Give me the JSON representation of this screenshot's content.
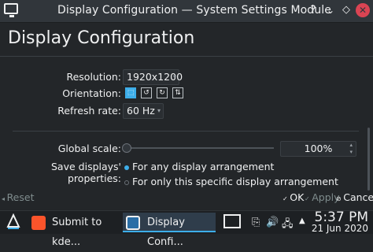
{
  "window": {
    "title": "Display Configuration — System Settings Module",
    "help": "?",
    "minimize": "⌄",
    "maximize": "◇",
    "close": "✕"
  },
  "page": {
    "heading": "Display Configuration"
  },
  "resolution": {
    "label": "Resolution:",
    "value": "1920x1200"
  },
  "orientation": {
    "label": "Orientation:",
    "options": [
      "landscape",
      "rotate-left",
      "rotate-right",
      "portrait-flipped"
    ],
    "selected": 0
  },
  "refresh": {
    "label": "Refresh rate:",
    "value": "60 Hz"
  },
  "scale": {
    "label": "Global scale:",
    "value": "100%",
    "level": 0.0
  },
  "save": {
    "label": "Save displays' properties:",
    "option1": "For any display arrangement",
    "option2": "For only this specific display arrangement",
    "selected": 0
  },
  "buttons": {
    "reset": "Reset",
    "ok": "OK",
    "apply": "Apply",
    "cancel": "Cancel"
  },
  "taskbar": {
    "task1": "Submit to kde...",
    "task2": "Display Confi...",
    "clock_time": "5:37 PM",
    "clock_date": "21 Jun 2020"
  },
  "colors": {
    "accent": "#3daee9",
    "background": "#232629",
    "close": "#da4453",
    "brave": "#fb542b"
  }
}
